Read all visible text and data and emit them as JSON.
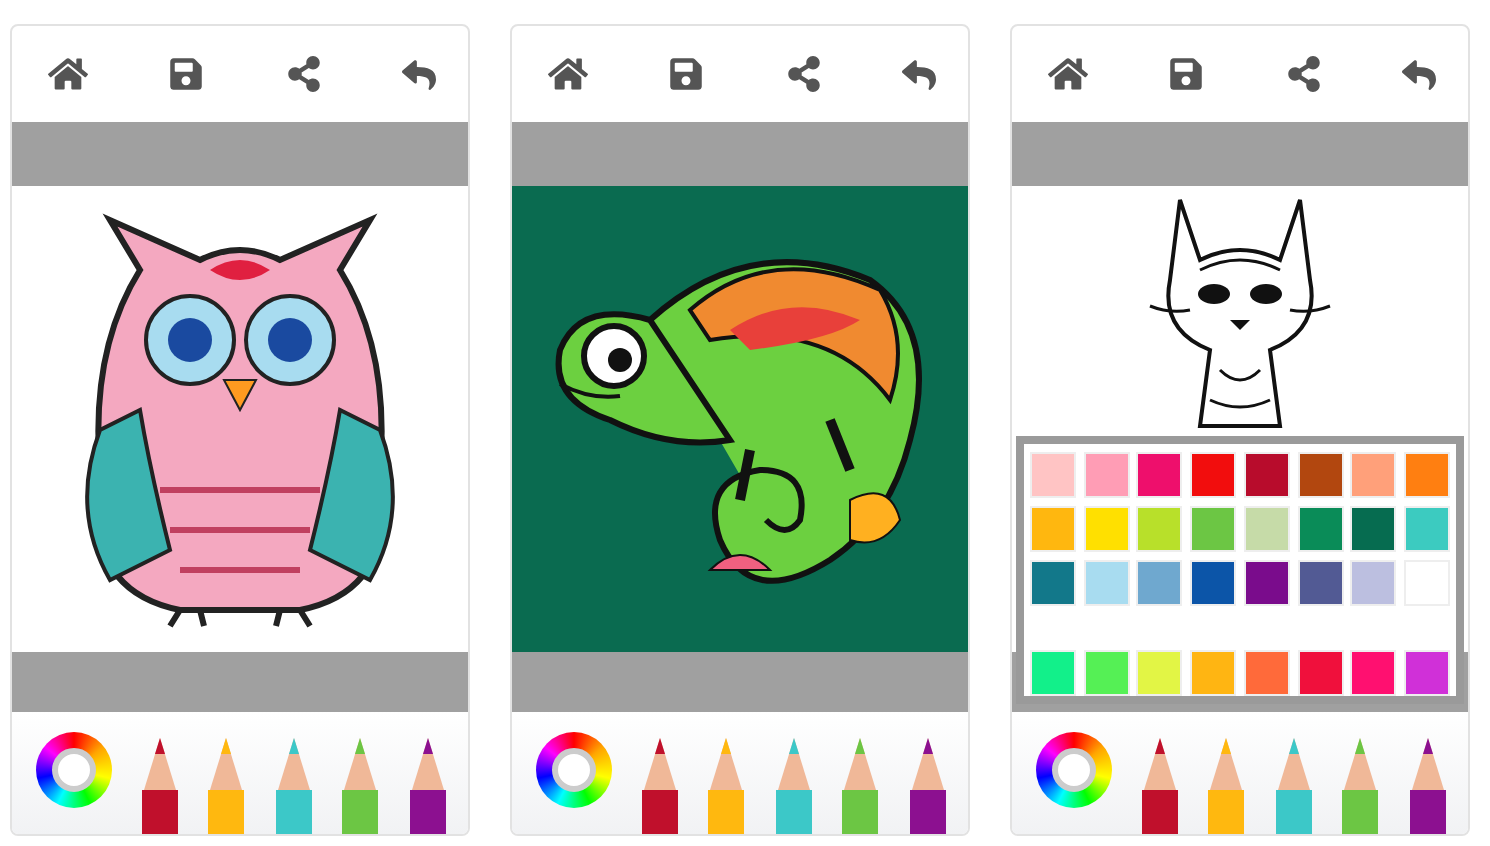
{
  "screens": [
    {
      "artwork": {
        "kind": "owl"
      },
      "pencils": [
        {
          "color": "#c0102c"
        },
        {
          "color": "#ffb80f"
        },
        {
          "color": "#3cc8c8"
        },
        {
          "color": "#6cc644"
        },
        {
          "color": "#8c1090"
        }
      ],
      "palette": {
        "open": false
      }
    },
    {
      "artwork": {
        "kind": "chameleon"
      },
      "pencils": [
        {
          "color": "#c0102c"
        },
        {
          "color": "#ffb80f"
        },
        {
          "color": "#3cc8c8"
        },
        {
          "color": "#6cc644"
        },
        {
          "color": "#8c1090"
        }
      ],
      "palette": {
        "open": false
      }
    },
    {
      "artwork": {
        "kind": "cat"
      },
      "pencils": [
        {
          "color": "#c0102c"
        },
        {
          "color": "#ffb80f"
        },
        {
          "color": "#3cc8c8"
        },
        {
          "color": "#6cc644"
        },
        {
          "color": "#8c1090"
        }
      ],
      "palette": {
        "open": true,
        "rows": [
          {
            "swatches": [
              {
                "color": "#ffc4c4"
              },
              {
                "color": "#ff9db5"
              },
              {
                "color": "#ee0f6c"
              },
              {
                "color": "#f20d0d"
              },
              {
                "color": "#b80c2c"
              },
              {
                "color": "#b2470f"
              },
              {
                "color": "#ffa07a"
              },
              {
                "color": "#ff7f11"
              }
            ]
          },
          {
            "swatches": [
              {
                "color": "#ffb70f"
              },
              {
                "color": "#ffe000"
              },
              {
                "color": "#b8e02a"
              },
              {
                "color": "#6cc644"
              },
              {
                "color": "#c6dba8"
              },
              {
                "color": "#0a8c58"
              },
              {
                "color": "#066c50"
              },
              {
                "color": "#3ccbc0"
              }
            ]
          },
          {
            "swatches": [
              {
                "color": "#12788a"
              },
              {
                "color": "#a8dcf0"
              },
              {
                "color": "#6fa8cf"
              },
              {
                "color": "#0c55a8"
              },
              {
                "color": "#7a0c8c"
              },
              {
                "color": "#525a94"
              },
              {
                "color": "#bcbfe0"
              },
              {
                "color": "#ffffff"
              }
            ]
          },
          {
            "swatches": [
              {
                "color": "#12f08a"
              },
              {
                "color": "#55f055"
              },
              {
                "color": "#e2f545"
              },
              {
                "color": "#ffb512"
              },
              {
                "color": "#ff6a3a"
              },
              {
                "color": "#f0103c"
              },
              {
                "color": "#ff1070"
              },
              {
                "color": "#d030d8"
              }
            ]
          }
        ]
      }
    }
  ]
}
